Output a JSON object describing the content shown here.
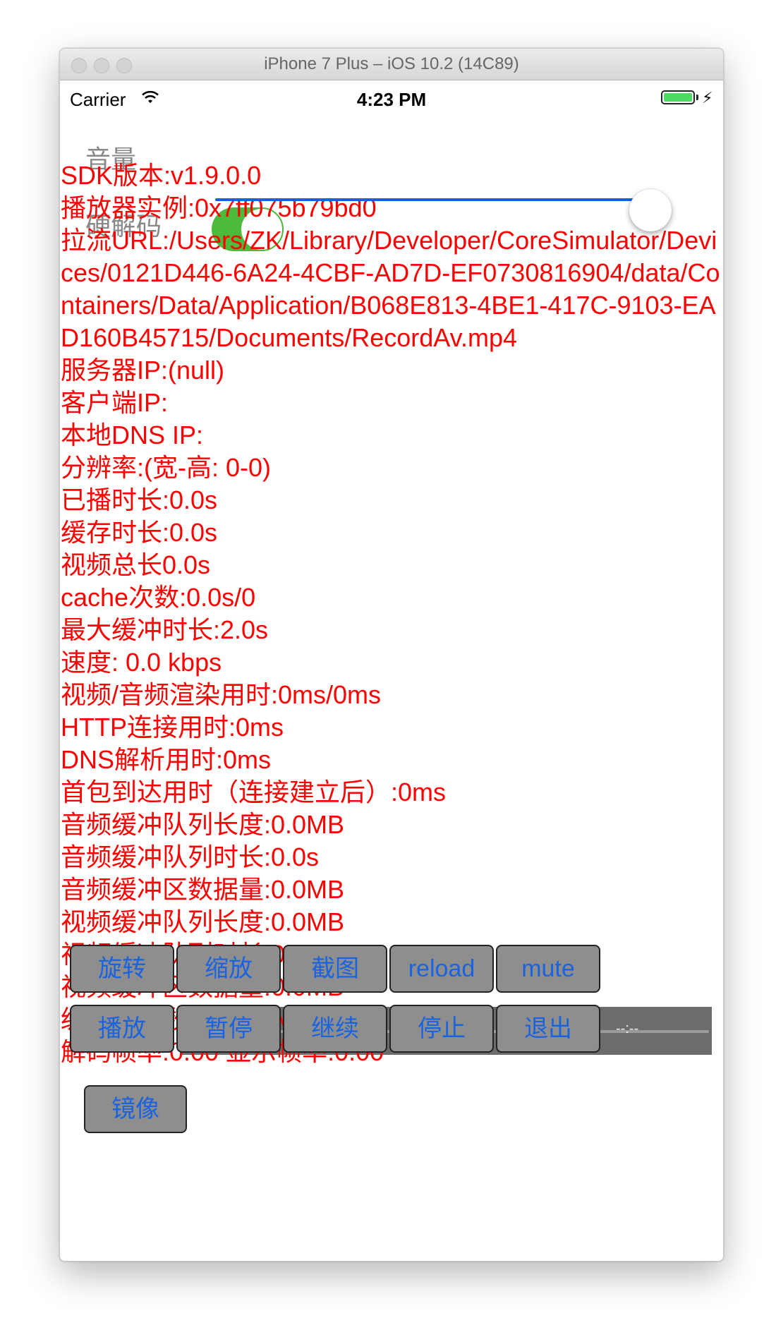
{
  "window": {
    "title": "iPhone 7 Plus – iOS 10.2 (14C89)"
  },
  "status_bar": {
    "carrier": "Carrier",
    "time": "4:23 PM",
    "battery_percent": 100
  },
  "volume": {
    "label": "音量",
    "value_fraction": 0.97,
    "accent": "#0f62e8"
  },
  "hardware_decode": {
    "label": "硬解码",
    "on": true,
    "color": "#4cbb3d"
  },
  "progress": {
    "current_time": "--:--",
    "total_time": "--:--"
  },
  "mirror_button": {
    "label": "镜像"
  },
  "info": {
    "color": "#ff0000",
    "lines": [
      "SDK版本:v1.9.0.0",
      "播放器实例:0x7ff075b79bd0",
      "拉流URL:/Users/ZK/Library/Developer/CoreSimulator/Devices/0121D446-6A24-4CBF-AD7D-EF0730816904/data/Containers/Data/Application/B068E813-4BE1-417C-9103-EAD160B45715/Documents/RecordAv.mp4",
      "服务器IP:(null)",
      "客户端IP:",
      "本地DNS IP:",
      "分辨率:(宽-高: 0-0)",
      "已播时长:0.0s",
      "缓存时长:0.0s",
      "视频总长0.0s",
      "cache次数:0.0s/0",
      "最大缓冲时长:2.0s",
      "速度: 0.0 kbps",
      "视频/音频渲染用时:0ms/0ms",
      "HTTP连接用时:0ms",
      "DNS解析用时:0ms",
      "首包到达用时（连接建立后）:0ms",
      "音频缓冲队列长度:0.0MB",
      "音频缓冲队列时长:0.0s",
      "音频缓冲区数据量:0.0MB",
      "视频缓冲队列长度:0.0MB",
      "视频缓冲队列时长:0.0s",
      "视频缓冲区数据量:0.0MB",
      "缓冲区总数据量0.0MB",
      "解码帧率:0.00 显示帧率:0.00"
    ]
  },
  "controls": {
    "row1": [
      "旋转",
      "缩放",
      "截图",
      "reload",
      "mute"
    ],
    "row2": [
      "播放",
      "暂停",
      "继续",
      "停止",
      "退出"
    ]
  }
}
